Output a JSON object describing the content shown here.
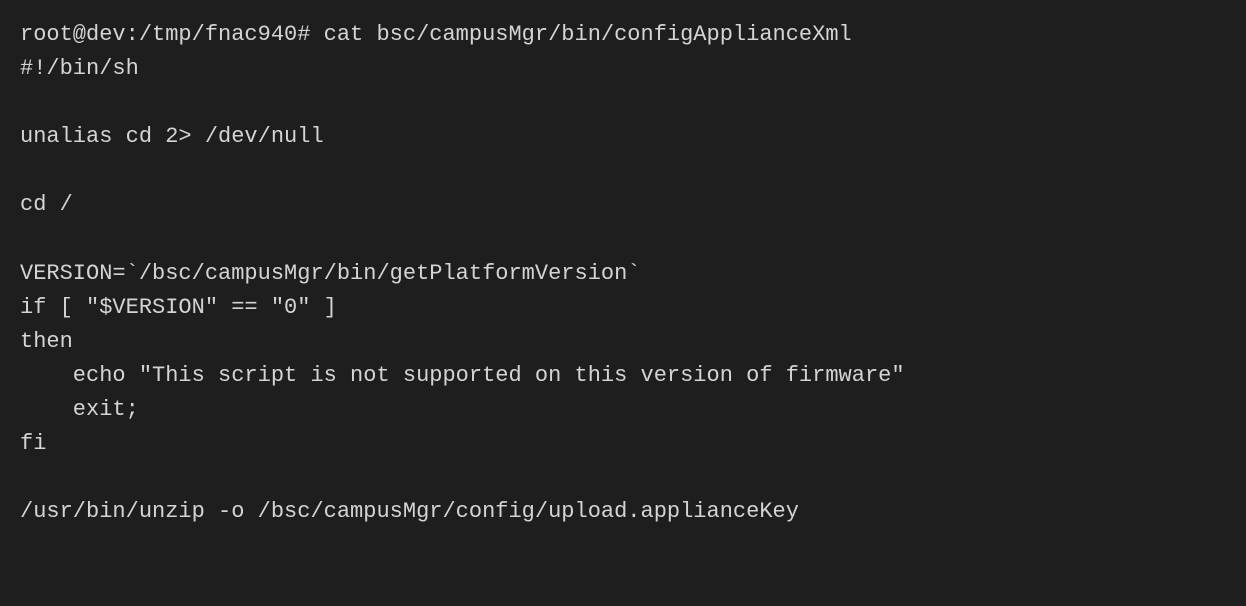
{
  "terminal": {
    "lines": [
      {
        "id": "line1",
        "text": "root@dev:/tmp/fnac940# cat bsc/campusMgr/bin/configApplianceXml"
      },
      {
        "id": "line2",
        "text": "#!/bin/sh"
      },
      {
        "id": "line3",
        "text": ""
      },
      {
        "id": "line4",
        "text": "unalias cd 2> /dev/null"
      },
      {
        "id": "line5",
        "text": ""
      },
      {
        "id": "line6",
        "text": "cd /"
      },
      {
        "id": "line7",
        "text": ""
      },
      {
        "id": "line8",
        "text": "VERSION=`/bsc/campusMgr/bin/getPlatformVersion`"
      },
      {
        "id": "line9",
        "text": "if [ \"$VERSION\" == \"0\" ]"
      },
      {
        "id": "line10",
        "text": "then"
      },
      {
        "id": "line11",
        "text": "    echo \"This script is not supported on this version of firmware\""
      },
      {
        "id": "line12",
        "text": "    exit;"
      },
      {
        "id": "line13",
        "text": "fi"
      },
      {
        "id": "line14",
        "text": ""
      },
      {
        "id": "line15",
        "text": "/usr/bin/unzip -o /bsc/campusMgr/config/upload.applianceKey"
      }
    ]
  }
}
